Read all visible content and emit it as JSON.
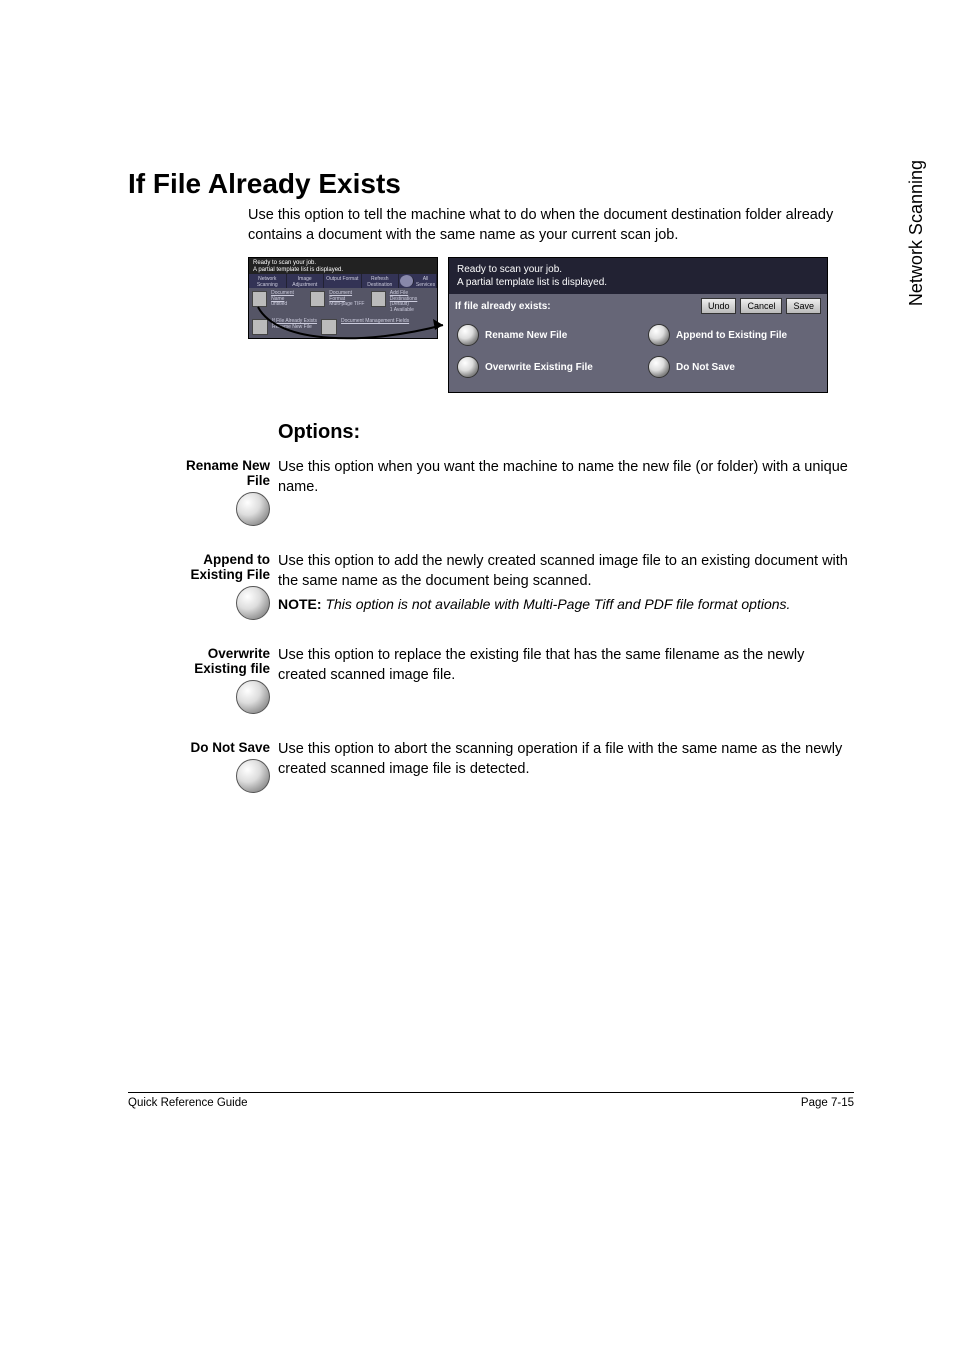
{
  "side_label": "Network Scanning",
  "title": "If File Already Exists",
  "intro": "Use this option to tell the machine what to do when the document destination folder already contains a document with the same name as your current scan job.",
  "small_panel": {
    "status_l1": "Ready to scan your job.",
    "status_l2": "A partial template list is displayed.",
    "tab1": "Network Scanning",
    "tab2": "Image Adjustment",
    "tab3": "Output Format",
    "tab4": "Refresh Destination",
    "tab5": "All Services",
    "b1a": "Document Name",
    "b1a2": "untitled",
    "b1b": "Document Format",
    "b1b2": "Multi-page TIFF",
    "b1c": "Add File Destinations",
    "b1c2": "(Default)",
    "b1c3": "1 Available",
    "b2a": "If File Already Exists",
    "b2a2": "Rename New File",
    "b2b": "Document Management Fields"
  },
  "big_panel": {
    "status_l1": "Ready to scan your job.",
    "status_l2": "A partial template list is displayed.",
    "bar_label": "If file already exists:",
    "btn_undo": "Undo",
    "btn_cancel": "Cancel",
    "btn_save": "Save",
    "opt1": "Rename New File",
    "opt2": "Append to Existing File",
    "opt3": "Overwrite Existing File",
    "opt4": "Do Not Save"
  },
  "options_heading": "Options:",
  "options": [
    {
      "label_l1": "Rename New",
      "label_l2": "File",
      "body": "Use this option when you want the machine to name the new file (or folder) with a unique name."
    },
    {
      "label_l1": "Append to",
      "label_l2": "Existing File",
      "body": "Use this option to add the newly created scanned image file to an existing document with the same name as the document being scanned.",
      "note_prefix": "NOTE: ",
      "note_body": "This option is not available with Multi-Page Tiff and PDF file format options."
    },
    {
      "label_l1": "Overwrite",
      "label_l2": "Existing file",
      "body": "Use this option to replace the existing file that has the same filename as the newly created scanned image file."
    },
    {
      "label_l1": "Do Not Save",
      "label_l2": "",
      "body": "Use this option to abort the scanning operation if a file with the same name as the newly created scanned image file is detected."
    }
  ],
  "footer_left": "Quick Reference Guide",
  "footer_right": "Page 7-15"
}
